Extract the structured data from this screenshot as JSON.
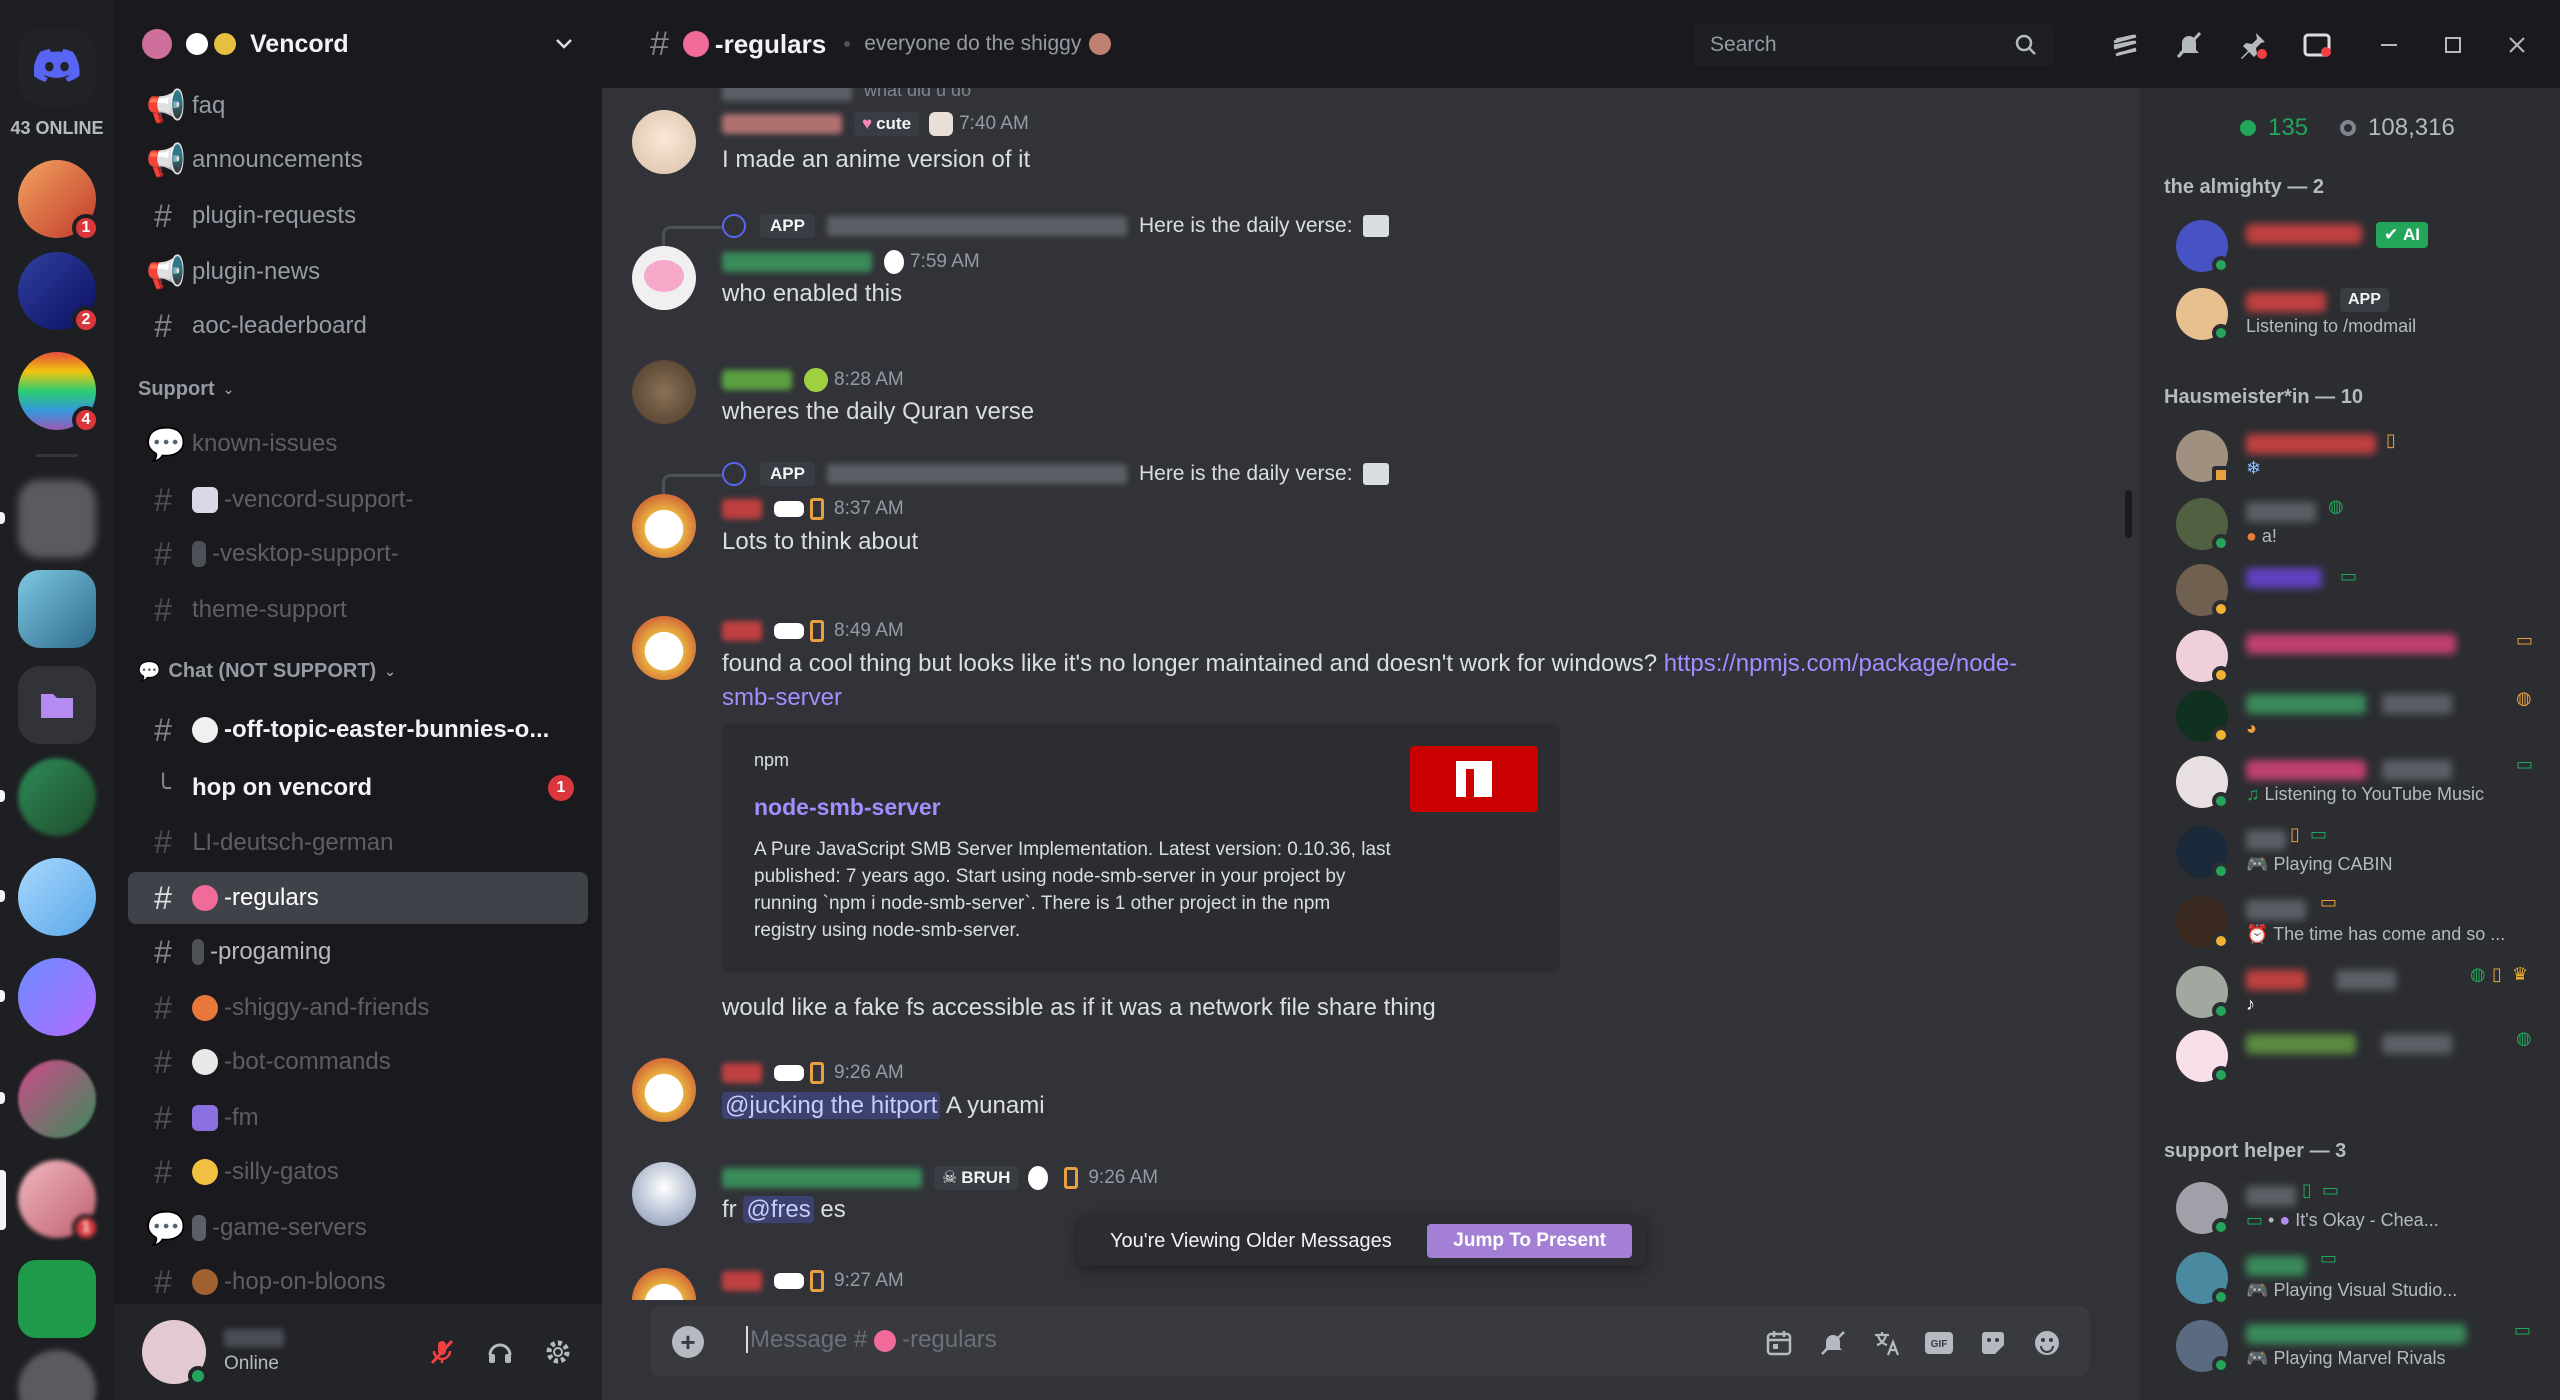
{
  "servers": {
    "online_label": "43 ONLINE",
    "badges": [
      "1",
      "2",
      "4",
      "1"
    ]
  },
  "guild": {
    "name": "Vencord"
  },
  "channels": [
    {
      "name": "faq"
    },
    {
      "name": "announcements"
    },
    {
      "name": "plugin-requests"
    },
    {
      "name": "plugin-news"
    },
    {
      "name": "aoc-leaderboard"
    }
  ],
  "categories": {
    "support": "Support",
    "chat": "Chat (NOT SUPPORT)"
  },
  "support_channels": [
    {
      "name": "known-issues"
    },
    {
      "name": "-vencord-support-"
    },
    {
      "name": "-vesktop-support-"
    },
    {
      "name": "theme-support"
    }
  ],
  "chat_channels": [
    {
      "name": "-off-topic-easter-bunnies-o..."
    },
    {
      "name": "hop on vencord",
      "badge": "1"
    },
    {
      "name": "ꓡI-deutsch-german"
    },
    {
      "name": "-regulars"
    },
    {
      "name": "-progaming"
    },
    {
      "name": "-shiggy-and-friends"
    },
    {
      "name": "-bot-commands"
    },
    {
      "name": "-fm"
    },
    {
      "name": "-silly-gatos"
    },
    {
      "name": "-game-servers"
    },
    {
      "name": "-hop-on-bloons"
    }
  ],
  "user_panel": {
    "status": "Online"
  },
  "header": {
    "channel": "-regulars",
    "topic": "everyone do the shiggy",
    "search_placeholder": "Search"
  },
  "messages": [
    {
      "tag": "cute",
      "time": "7:40 AM",
      "text": "I made an anime version of it",
      "prev_snippet": "what did u do"
    },
    {
      "reply_app": "APP",
      "reply_text": "Here is the daily verse:",
      "time": "7:59 AM",
      "text": "who enabled this"
    },
    {
      "time": "8:28 AM",
      "text": "wheres the daily Quran verse"
    },
    {
      "reply_app": "APP",
      "reply_text": "Here is the daily verse:",
      "time": "8:37 AM",
      "text": "Lots to think about"
    },
    {
      "time": "8:49 AM",
      "text": "found a cool thing but looks like it's no longer maintained and doesn't work for windows?",
      "link1": "https://npmjs.com/package/node-",
      "link2": "smb-server"
    },
    {
      "text": "would like a fake fs accessible as if it was a network file share thing"
    },
    {
      "time": "9:26 AM",
      "mention": "@jucking the hitport",
      "text": "A yunami"
    },
    {
      "tag": "BRUH",
      "time": "9:26 AM",
      "text_pre": "fr",
      "mention": "@fres",
      "text": "es"
    },
    {
      "time": "9:27 AM"
    }
  ],
  "embed": {
    "provider": "npm",
    "title": "node-smb-server",
    "description": "A Pure JavaScript SMB Server Implementation. Latest version: 0.10.36, last published: 7 years ago. Start using node-smb-server in your project by running `npm i node-smb-server`. There is 1 other project in the npm registry using node-smb-server."
  },
  "older_bar": {
    "text": "You're Viewing Older Messages",
    "button": "Jump To Present"
  },
  "composer": {
    "placeholder": "Message #",
    "placeholder_channel": "-regulars"
  },
  "members": {
    "online_count": "135",
    "total_count": "108,316",
    "roles": [
      {
        "label": "the almighty — 2"
      },
      {
        "label": "Hausmeister*in — 10"
      },
      {
        "label": "support helper — 3"
      }
    ],
    "activities": {
      "ai_tag": "AI",
      "app_tag": "APP",
      "modmail": "Listening to /modmail",
      "ytm": "Listening to YouTube Music",
      "cabin": "Playing CABIN",
      "time_has_come": "The time has come and so ...",
      "its_okay": "It's Okay - Chea...",
      "vscode": "Playing Visual Studio...",
      "marvel": "Playing Marvel Rivals",
      "a_excl": "a!"
    }
  }
}
